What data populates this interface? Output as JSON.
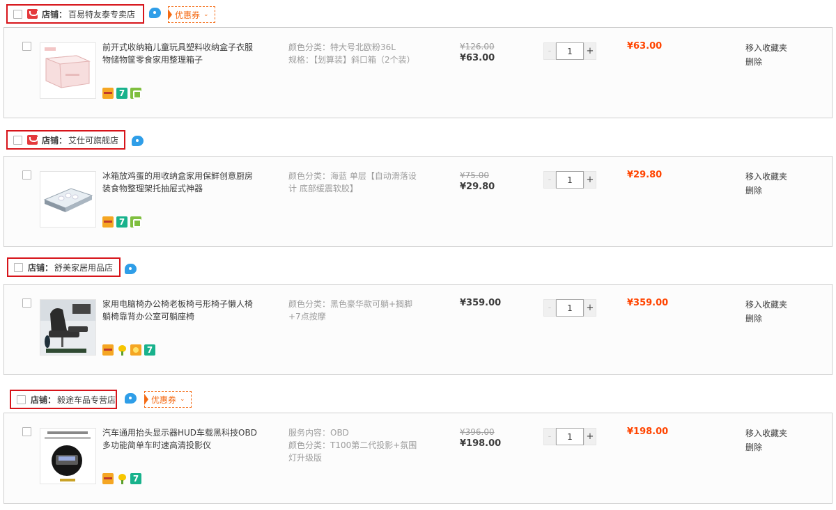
{
  "stores": [
    {
      "label": "店铺：",
      "name": "百易特友泰专卖店",
      "coupon": "优惠券",
      "item": {
        "title": "前开式收纳箱儿童玩具塑料收纳盒子衣服物储物筐零食家用整理箱子",
        "props": [
          "颜色分类：特大号北欧粉36L",
          "规格：【划算装】斜口箱（2个装）"
        ],
        "original_price": "¥126.00",
        "price": "¥63.00",
        "quantity": "1",
        "subtotal": "¥63.00",
        "services": [
          "card",
          "seven",
          "gift"
        ]
      }
    },
    {
      "label": "店铺：",
      "name": "艾仕可旗舰店",
      "item": {
        "title": "冰箱放鸡蛋的用收纳盒家用保鲜创意厨房装食物整理架托抽屉式神器",
        "props": [
          "颜色分类：海蓝 单层【自动滑落设计 底部缓震软胶】"
        ],
        "original_price": "¥75.00",
        "price": "¥29.80",
        "quantity": "1",
        "subtotal": "¥29.80",
        "services": [
          "card",
          "seven",
          "gift"
        ]
      }
    },
    {
      "label": "店铺：",
      "name": "舒美家居用品店",
      "item": {
        "title": "家用电脑椅办公椅老板椅弓形椅子懒人椅躺椅靠背办公室可躺座椅",
        "props": [
          "颜色分类：黑色豪华款可躺+搁脚+7点按摩"
        ],
        "original_price": "",
        "price": "¥359.00",
        "quantity": "1",
        "subtotal": "¥359.00",
        "services": [
          "card",
          "flower",
          "sun",
          "seven"
        ]
      }
    },
    {
      "label": "店铺：",
      "name": "毅途车品专营店",
      "coupon": "优惠券",
      "item": {
        "title": "汽车通用抬头显示器HUD车载黑科技OBD多功能简单车时速高清投影仪",
        "props": [
          "服务内容：OBD",
          "颜色分类：T100第二代投影+氛围灯升级版"
        ],
        "original_price": "¥396.00",
        "price": "¥198.00",
        "quantity": "1",
        "subtotal": "¥198.00",
        "services": [
          "card",
          "flower",
          "seven"
        ]
      }
    }
  ],
  "actions": {
    "favorite": "移入收藏夹",
    "delete": "删除"
  },
  "qty_controls": {
    "minus": "-",
    "plus": "+"
  },
  "colors": {
    "accent": "#ff4400",
    "header_border": "#d7141a",
    "coupon": "#f46a13"
  }
}
